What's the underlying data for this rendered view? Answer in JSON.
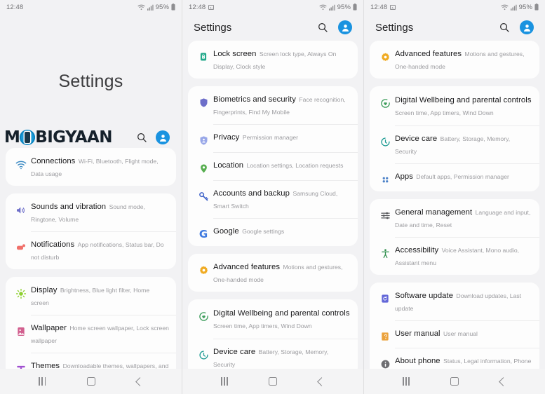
{
  "colors": {
    "screen_bg": "#f2f2f4",
    "card_bg": "#fdfdfd",
    "accent_blue": "#1a93e0",
    "title_text": "#19191b",
    "sub_text": "#9b9b9f"
  },
  "status_bar": {
    "time": "12:48",
    "battery_percent": "95%",
    "icons": [
      "screenshot-icon",
      "wifi-icon",
      "signal-icon",
      "battery-icon"
    ]
  },
  "nav_bar": {
    "recent_label": "recent-apps",
    "home_label": "home",
    "back_label": "back"
  },
  "watermark": {
    "text_before": "M",
    "text_after": "BIGYAAN",
    "search_icon": "search-icon",
    "avatar_icon": "account-avatar-icon"
  },
  "screens": [
    {
      "id": "screen-1",
      "hero_title": "Settings",
      "has_appbar": false,
      "has_watermark": true,
      "show_screenshot_icon": false,
      "cards": [
        {
          "rows": [
            {
              "icon": "wifi-icon",
              "color": "#3f8cc4",
              "title": "Connections",
              "subtitle": "Wi-Fi, Bluetooth, Flight mode, Data usage"
            }
          ]
        },
        {
          "rows": [
            {
              "icon": "speaker-icon",
              "color": "#6d6ec9",
              "title": "Sounds and vibration",
              "subtitle": "Sound mode, Ringtone, Volume"
            },
            {
              "icon": "notification-icon",
              "color": "#f0706a",
              "title": "Notifications",
              "subtitle": "App notifications, Status bar, Do not disturb"
            }
          ]
        },
        {
          "rows": [
            {
              "icon": "brightness-icon",
              "color": "#8ed030",
              "title": "Display",
              "subtitle": "Brightness, Blue light filter, Home screen"
            },
            {
              "icon": "wallpaper-icon",
              "color": "#d2608f",
              "title": "Wallpaper",
              "subtitle": "Home screen wallpaper, Lock screen wallpaper"
            },
            {
              "icon": "themes-icon",
              "color": "#a04fd0",
              "title": "Themes",
              "subtitle": "Downloadable themes, wallpapers, and icons"
            }
          ]
        }
      ]
    },
    {
      "id": "screen-2",
      "appbar_title": "Settings",
      "has_appbar": true,
      "has_watermark": false,
      "show_screenshot_icon": true,
      "cards": [
        {
          "rows": [
            {
              "icon": "lock-icon",
              "color": "#24a98b",
              "title": "Lock screen",
              "subtitle": "Screen lock type, Always On Display, Clock style"
            }
          ]
        },
        {
          "rows": [
            {
              "icon": "shield-icon",
              "color": "#6d6ec9",
              "title": "Biometrics and security",
              "subtitle": "Face recognition, Fingerprints, Find My Mobile"
            },
            {
              "icon": "privacy-shield-icon",
              "color": "#98a7e8",
              "title": "Privacy",
              "subtitle": "Permission manager"
            },
            {
              "icon": "location-pin-icon",
              "color": "#57ae50",
              "title": "Location",
              "subtitle": "Location settings, Location requests"
            },
            {
              "icon": "key-icon",
              "color": "#3f63c9",
              "title": "Accounts and backup",
              "subtitle": "Samsung Cloud, Smart Switch"
            },
            {
              "icon": "google-g-icon",
              "color": "#3f7ae0",
              "title": "Google",
              "subtitle": "Google settings"
            }
          ]
        },
        {
          "rows": [
            {
              "icon": "advanced-gear-icon",
              "color": "#f0ab23",
              "title": "Advanced features",
              "subtitle": "Motions and gestures, One-handed mode"
            }
          ]
        },
        {
          "rows": [
            {
              "icon": "wellbeing-heart-icon",
              "color": "#3e9e5c",
              "title": "Digital Wellbeing and parental controls",
              "subtitle": "Screen time, App timers, Wind Down"
            },
            {
              "icon": "device-care-icon",
              "color": "#1d9b93",
              "title": "Device care",
              "subtitle": "Battery, Storage, Memory, Security"
            }
          ]
        }
      ]
    },
    {
      "id": "screen-3",
      "appbar_title": "Settings",
      "has_appbar": true,
      "has_watermark": false,
      "show_screenshot_icon": true,
      "cards": [
        {
          "rows": [
            {
              "icon": "advanced-gear-icon",
              "color": "#f0ab23",
              "title": "Advanced features",
              "subtitle": "Motions and gestures, One-handed mode"
            }
          ]
        },
        {
          "rows": [
            {
              "icon": "wellbeing-heart-icon",
              "color": "#3e9e5c",
              "title": "Digital Wellbeing and parental controls",
              "subtitle": "Screen time, App timers, Wind Down"
            },
            {
              "icon": "device-care-icon",
              "color": "#1d9b93",
              "title": "Device care",
              "subtitle": "Battery, Storage, Memory, Security"
            },
            {
              "icon": "apps-grid-icon",
              "color": "#4d82c8",
              "title": "Apps",
              "subtitle": "Default apps, Permission manager"
            }
          ]
        },
        {
          "rows": [
            {
              "icon": "sliders-icon",
              "color": "#55565a",
              "title": "General management",
              "subtitle": "Language and input, Date and time, Reset"
            },
            {
              "icon": "accessibility-icon",
              "color": "#2f8f4d",
              "title": "Accessibility",
              "subtitle": "Voice Assistant, Mono audio, Assistant menu"
            }
          ]
        },
        {
          "rows": [
            {
              "icon": "software-update-icon",
              "color": "#6367d8",
              "title": "Software update",
              "subtitle": "Download updates, Last update"
            },
            {
              "icon": "user-manual-icon",
              "color": "#eba23c",
              "title": "User manual",
              "subtitle": "User manual"
            },
            {
              "icon": "info-icon",
              "color": "#6e6e72",
              "title": "About phone",
              "subtitle": "Status, Legal information, Phone name"
            }
          ]
        }
      ]
    }
  ]
}
